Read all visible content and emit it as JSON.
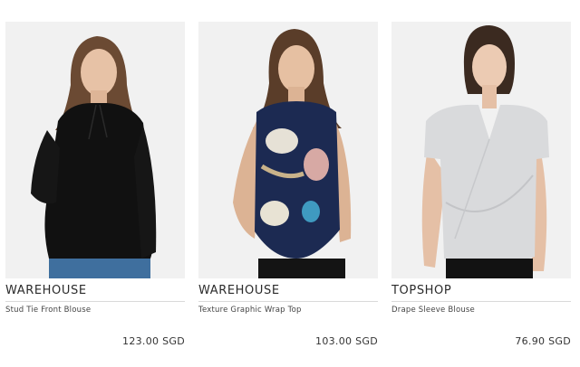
{
  "products": [
    {
      "brand": "WAREHOUSE",
      "name": "Stud Tie Front Blouse",
      "price": "123.00 SGD",
      "image_icon": "model-black-blouse"
    },
    {
      "brand": "WAREHOUSE",
      "name": "Texture Graphic Wrap Top",
      "price": "103.00 SGD",
      "image_icon": "model-floral-top"
    },
    {
      "brand": "TOPSHOP",
      "name": "Drape Sleeve Blouse",
      "price": "76.90 SGD",
      "image_icon": "model-grey-blouse"
    }
  ],
  "colors": {
    "photo_bg": "#f2f2f2",
    "text": "#333333",
    "divider": "#d9d9d9"
  }
}
